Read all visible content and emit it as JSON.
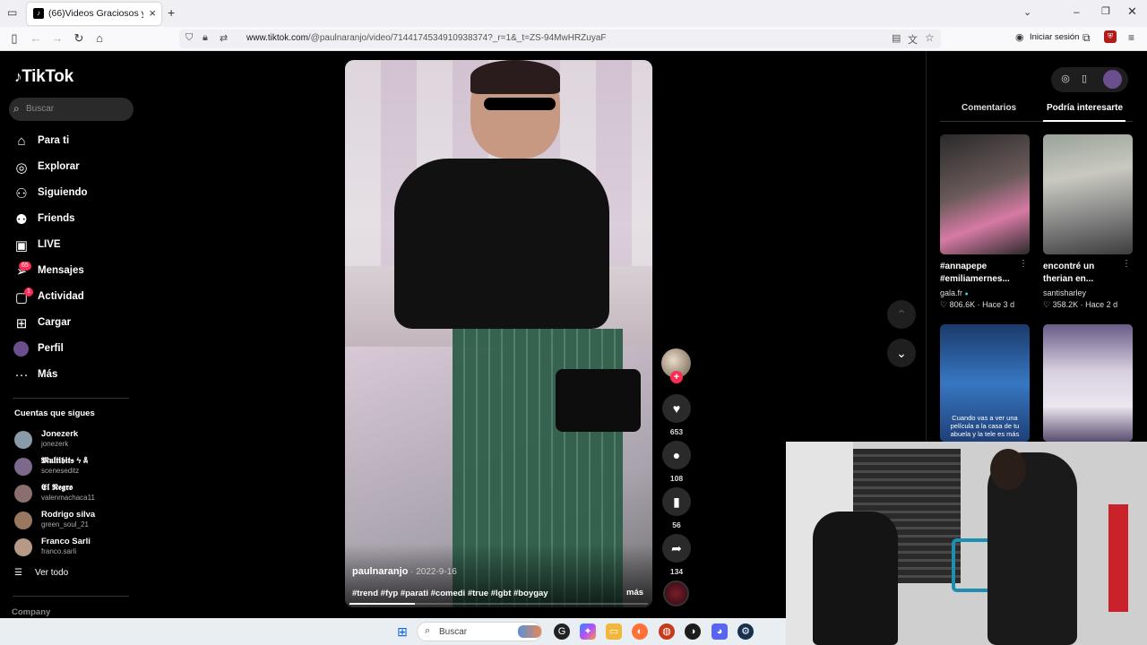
{
  "browser": {
    "tab_title": "(66)Videos Graciosos y Memes",
    "url_domain": "www.tiktok.com",
    "url_path": "/@paulnaranjo/video/7144174534910938374?_r=1&_t=ZS-94MwHRZuyaF",
    "login_label": "Iniciar sesión",
    "new_tab_symbol": "+",
    "close_symbol": "×"
  },
  "sidebar": {
    "logo": "TikTok",
    "search_placeholder": "Buscar",
    "nav": [
      {
        "label": "Para ti",
        "icon": "home-icon"
      },
      {
        "label": "Explorar",
        "icon": "compass-icon"
      },
      {
        "label": "Siguiendo",
        "icon": "following-icon"
      },
      {
        "label": "Friends",
        "icon": "friends-icon"
      },
      {
        "label": "LIVE",
        "icon": "live-icon"
      },
      {
        "label": "Mensajes",
        "icon": "messages-icon",
        "badge": "65"
      },
      {
        "label": "Actividad",
        "icon": "activity-icon",
        "badge": "1"
      },
      {
        "label": "Cargar",
        "icon": "upload-icon"
      },
      {
        "label": "Perfil",
        "icon": "profile-icon"
      },
      {
        "label": "Más",
        "icon": "more-icon"
      }
    ],
    "following_title": "Cuentas que sigues",
    "accounts": [
      {
        "name": "Jonezerk",
        "handle": "jonezerk"
      },
      {
        "name": "𝕸𝖚𝖑𝖙𝖎𝖇𝖎𝖙𝖘 ϟ ☠",
        "handle": "sceneseditz"
      },
      {
        "name": "𝕰𝖑 𝕹𝖊𝖌𝖗𝖔",
        "handle": "valenmachaca11"
      },
      {
        "name": "Rodrigo silva",
        "handle": "green_soul_21"
      },
      {
        "name": "Franco Sarli",
        "handle": "franco.sarli"
      }
    ],
    "see_all": "Ver todo",
    "company": "Company"
  },
  "video": {
    "author": "paulnaranjo",
    "date": " · 2022-9-16",
    "tags": "#trend #fyp #parati #comedi #true #lgbt #boygay",
    "more": "más",
    "progress": 0.22
  },
  "actions": {
    "likes": "653",
    "comments": "108",
    "saves": "56",
    "shares": "134"
  },
  "right_panel": {
    "tab_comments": "Comentarios",
    "tab_recommended": "Podría interesarte",
    "cards": [
      {
        "title1": "#annapepe",
        "title2": "#emiliamernes...",
        "author": "gala.fr",
        "verified": "●",
        "likes": "♡ 806.6K",
        "time": " · Hace 3 d"
      },
      {
        "title1": "encontré un",
        "title2": "therian en...",
        "author": "santisharley",
        "likes": "♡ 358.2K",
        "time": " · Hace 2 d"
      },
      {
        "caption": "Cuando vas a ver una película a la casa de tu abuela y la tele es más"
      },
      {
        "caption": ""
      }
    ]
  },
  "taskbar": {
    "search_placeholder": "Buscar"
  },
  "colors": {
    "accent": "#fe2c55",
    "bg": "#000000"
  }
}
